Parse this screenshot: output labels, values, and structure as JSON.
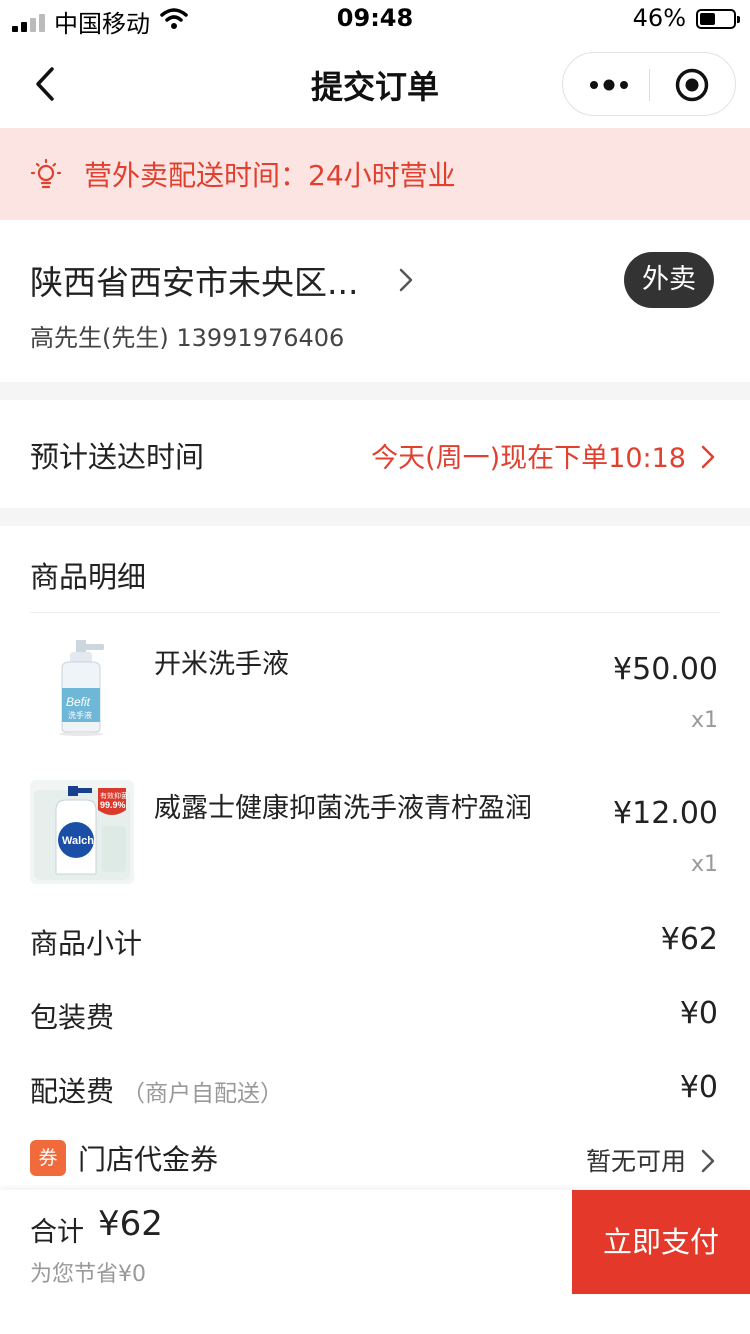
{
  "status_bar": {
    "carrier": "中国移动",
    "time": "09:48",
    "battery": "46%",
    "battery_level": 0.46
  },
  "nav": {
    "title": "提交订单",
    "back_icon": "chevron-left-icon",
    "more_icon": "more-dots-icon",
    "close_icon": "target-close-icon"
  },
  "notice": {
    "icon": "lightbulb-icon",
    "text": "营外卖配送时间：24小时营业"
  },
  "address": {
    "line": "陕西省西安市未央区...",
    "contact": "高先生(先生) 13991976406",
    "mode_badge": "外卖"
  },
  "delivery": {
    "label": "预计送达时间",
    "value": "今天(周一)现在下单10:18"
  },
  "details": {
    "header": "商品明细",
    "items": [
      {
        "name": "开米洗手液",
        "price": "¥50.00",
        "qty": "x1"
      },
      {
        "name": "威露士健康抑菌洗手液青柠盈润",
        "price": "¥12.00",
        "qty": "x1"
      }
    ],
    "thumb_texts": {
      "befit": "Befit",
      "befit_sub": "洗手液",
      "walch": "Walch",
      "walch_badge_1": "有效抑菌",
      "walch_badge_2": "99.9%"
    },
    "subtotal_label": "商品小计",
    "subtotal_value": "¥62",
    "packaging_label": "包装费",
    "packaging_value": "¥0",
    "delivery_fee_label": "配送费",
    "delivery_fee_hint": "（商户自配送）",
    "delivery_fee_value": "¥0",
    "coupon_icon": "券",
    "coupon_label": "门店代金券",
    "coupon_status": "暂无可用"
  },
  "footer": {
    "total_label": "合计",
    "total_value": "¥62",
    "saving": "为您节省¥0",
    "pay_button": "立即支付"
  },
  "colors": {
    "accent_red": "#e1402f",
    "pay_button": "#e4382a",
    "notice_bg": "#fbe4e2",
    "coupon_orange": "#f06a3c",
    "badge_dark": "#333333"
  }
}
